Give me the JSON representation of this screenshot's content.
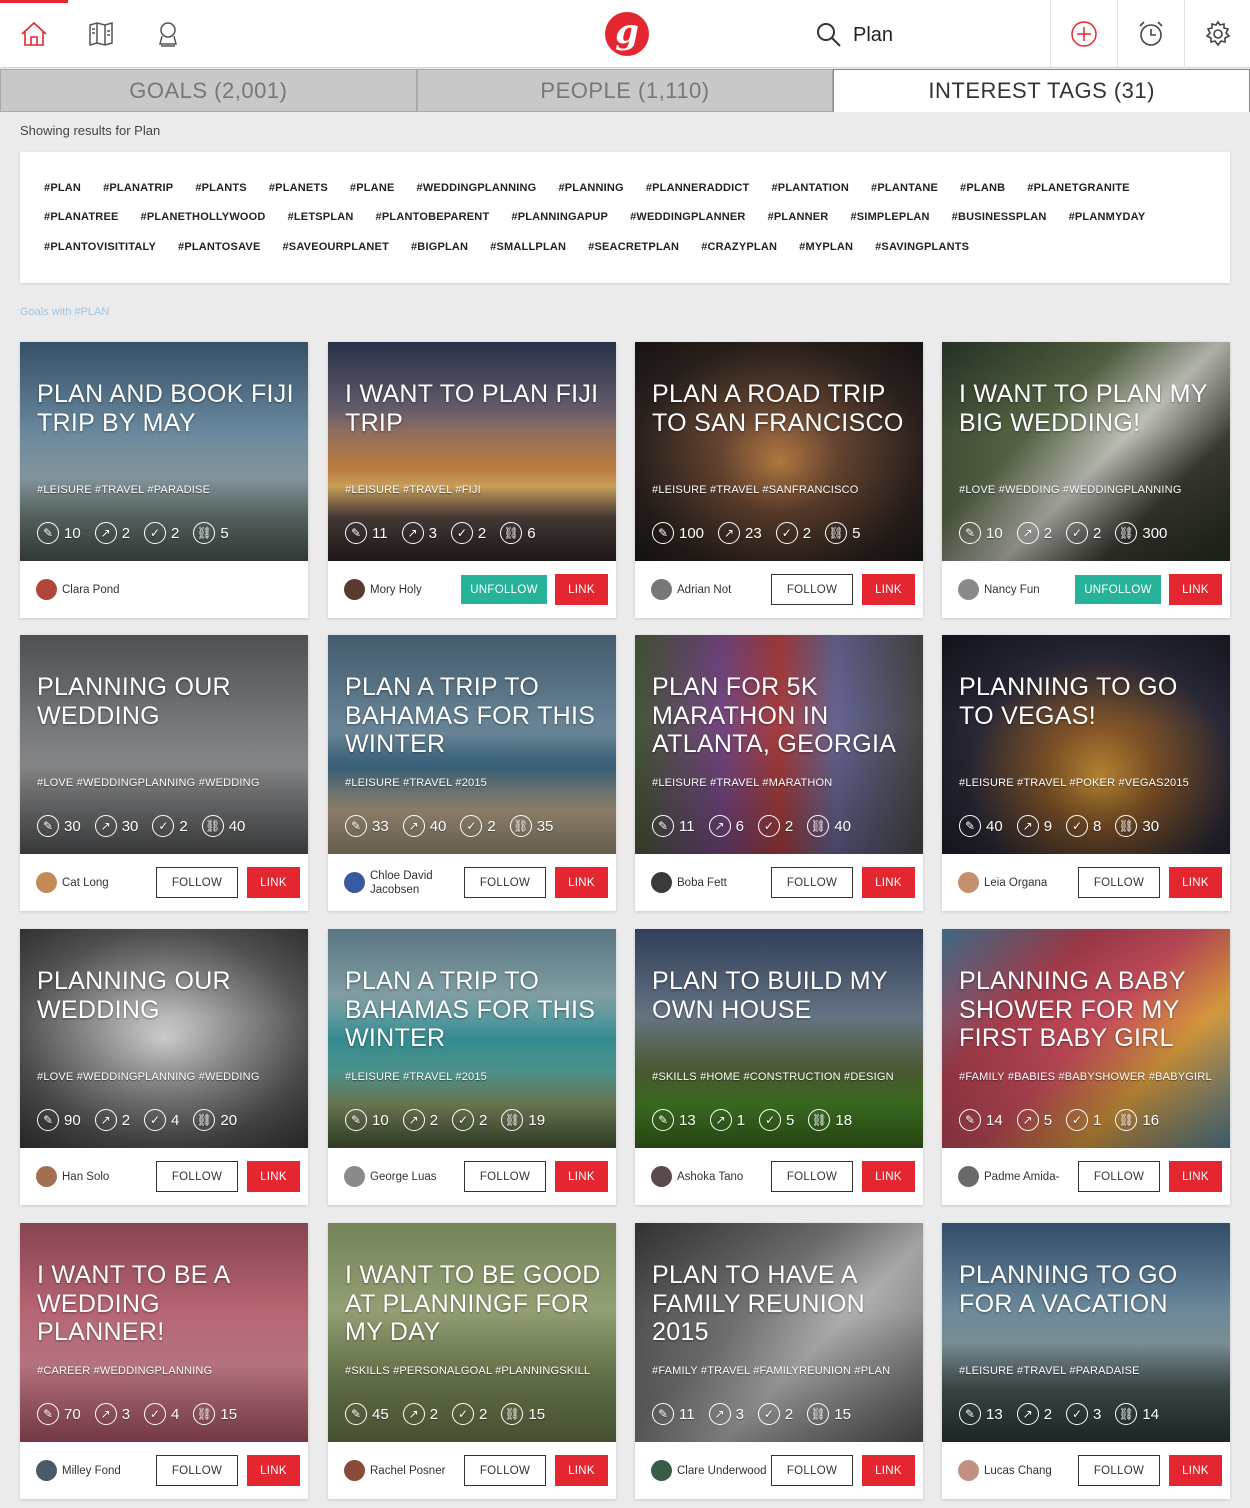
{
  "header": {
    "search_value": "Plan",
    "logo_letter": "g",
    "accent_color": "#e3262f"
  },
  "tabs": [
    {
      "label": "GOALS (2,001)",
      "active": false
    },
    {
      "label": "PEOPLE (1,110)",
      "active": false
    },
    {
      "label": "INTEREST TAGS (31)",
      "active": true
    }
  ],
  "results_text": "Showing results for Plan",
  "tag_rows": [
    [
      "#PLAN",
      "#PLANATRIP",
      "#PLANTS",
      "#PLANETS",
      "#PLANE",
      "#WEDDINGPLANNING",
      "#PLANNING",
      "#PLANNERADDICT",
      "#PLANTATION",
      "#PLANTANE",
      "#PLANB",
      "#PLANETGRANITE"
    ],
    [
      "#PLANATREE",
      "#PLANETHOLLYWOOD",
      "#LETSPLAN",
      "#PLANTOBEPARENT",
      "#PLANNINGAPUP",
      "#WEDDINGPLANNER",
      "#PLANNER",
      "#SIMPLEPLAN",
      "#BUSINESSPLAN",
      "#PLANMYDAY"
    ],
    [
      "#PLANTOVISITITALY",
      "#PLANTOSAVE",
      "#SAVEOURPLANET",
      "#BIGPLAN",
      "#SMALLPLAN",
      "#SEACRETPLAN",
      "#CRAZYPLAN",
      "#MYPLAN",
      "#SAVINGPLANTS"
    ]
  ],
  "section_label": "Goals with #PLAN",
  "cards": [
    {
      "title": "PLAN AND BOOK FIJI TRIP BY MAY",
      "tags": "#LEISURE #TRAVEL #PARADISE",
      "stats": [
        "10",
        "2",
        "2",
        "5"
      ],
      "owner": "Clara Pond",
      "action": "",
      "link": "",
      "bg": "linear-gradient(180deg,#3f5f77 0%,#6d8ea6 40%,#9bb0b8 62%,#6f7f7c 80%,#4c5652 100%)",
      "avatar": "#b0453a"
    },
    {
      "title": "I WANT TO PLAN FIJI TRIP",
      "tags": "#LEISURE #TRAVEL #FIJI",
      "stats": [
        "11",
        "3",
        "2",
        "6"
      ],
      "owner": "Mory Holy",
      "action": "UNFOLLOW",
      "link": "LINK",
      "bg": "linear-gradient(180deg,#2f3a55 0%,#6a6272 30%,#d98f4a 58%,#f3c06c 66%,#5b4a45 80%,#2d2624 100%)",
      "avatar": "#5a3a2e"
    },
    {
      "title": "PLAN A ROAD TRIP TO SAN FRANCISCO",
      "tags": "#LEISURE #TRAVEL #SANFRANCISCO",
      "stats": [
        "100",
        "23",
        "2",
        "5"
      ],
      "owner": "Adrian Not",
      "action": "FOLLOW",
      "link": "LINK",
      "bg": "radial-gradient(ellipse at 50% 55%,#c8874a 0%,#6e4a35 30%,#2e2420 70%,#1a1614 100%)",
      "avatar": "#777777"
    },
    {
      "title": "I WANT TO PLAN MY BIG WEDDING!",
      "tags": "#LOVE #WEDDING #WEDDINGPLANNING",
      "stats": [
        "10",
        "2",
        "2",
        "300"
      ],
      "owner": "Nancy Fun",
      "action": "UNFOLLOW",
      "link": "LINK",
      "bg": "linear-gradient(135deg,#2c3a2a 0%,#5a6a48 35%,#c9ccc2 55%,#3d3f35 75%,#27301f 100%)",
      "avatar": "#8a8a8a"
    },
    {
      "title": "PLANNING OUR WEDDING",
      "tags": "#LOVE #WEDDINGPLANNING #WEDDING",
      "stats": [
        "30",
        "30",
        "2",
        "40"
      ],
      "owner": "Cat Long",
      "action": "FOLLOW",
      "link": "LINK",
      "bg": "linear-gradient(180deg,#5c5f62 0%,#7a7d80 40%,#9a9c9e 60%,#56585a 100%)",
      "avatar": "#c48a55"
    },
    {
      "title": "PLAN A TRIP TO BAHAMAS FOR THIS WINTER",
      "tags": "#LEISURE #TRAVEL #2015",
      "stats": [
        "33",
        "40",
        "2",
        "35"
      ],
      "owner": "Chloe David Jacobsen",
      "action": "FOLLOW",
      "link": "LINK",
      "bg": "linear-gradient(180deg,#4f6c80 0%,#6f8da0 45%,#3f6f8a 60%,#b8a58a 80%,#9c8e78 100%)",
      "avatar": "#3a5aa0"
    },
    {
      "title": "PLAN FOR 5K MARATHON IN ATLANTA, GEORGIA",
      "tags": "#LEISURE #TRAVEL #MARATHON",
      "stats": [
        "11",
        "6",
        "2",
        "40"
      ],
      "owner": "Boba Fett",
      "action": "FOLLOW",
      "link": "LINK",
      "bg": "linear-gradient(90deg,#4a5a3a 0%,#7a4a8a 30%,#b04040 50%,#6a6a9a 70%,#4a4a4a 100%)",
      "avatar": "#3a3a3a"
    },
    {
      "title": "PLANNING TO GO TO VEGAS!",
      "tags": "#LEISURE #TRAVEL #POKER #VEGAS2015",
      "stats": [
        "40",
        "9",
        "8",
        "30"
      ],
      "owner": "Leia Organa",
      "action": "FOLLOW",
      "link": "LINK",
      "bg": "radial-gradient(ellipse at 55% 65%,#d89a3a 0%,#8a5a2a 25%,#2a2a3a 60%,#15151f 100%)",
      "avatar": "#c49070"
    },
    {
      "title": "PLANNING OUR WEDDING",
      "tags": "#LOVE #WEDDINGPLANNING #WEDDING",
      "stats": [
        "90",
        "2",
        "4",
        "20"
      ],
      "owner": "Han Solo",
      "action": "FOLLOW",
      "link": "LINK",
      "bg": "radial-gradient(ellipse at 50% 50%,#e0e0e0 0%,#9a9a9a 35%,#5a5a5a 70%,#3a3a3a 100%)",
      "avatar": "#a07050"
    },
    {
      "title": "PLAN A TRIP TO BAHAMAS FOR THIS WINTER",
      "tags": "#LEISURE #TRAVEL #2015",
      "stats": [
        "10",
        "2",
        "2",
        "19"
      ],
      "owner": "George Luas",
      "action": "FOLLOW",
      "link": "LINK",
      "bg": "linear-gradient(180deg,#6a8a9a 0%,#8aaab0 30%,#3a9aa0 50%,#5ab0a8 65%,#8a9a6a 80%,#4a5a3a 100%)",
      "avatar": "#8a8a8a"
    },
    {
      "title": "PLAN TO BUILD MY OWN HOUSE",
      "tags": "#SKILLS #HOME #CONSTRUCTION #DESIGN",
      "stats": [
        "13",
        "1",
        "5",
        "18"
      ],
      "owner": "Ashoka Tano",
      "action": "FOLLOW",
      "link": "LINK",
      "bg": "linear-gradient(180deg,#3a4a6a 0%,#6a7a8a 40%,#5a6a3a 65%,#4a8a2a 80%,#3a6a1a 100%)",
      "avatar": "#5a4a4a"
    },
    {
      "title": "PLANNING A BABY SHOWER FOR MY FIRST BABY GIRL",
      "tags": "#FAMILY #BABIES #BABYSHOWER #BABYGIRL",
      "stats": [
        "14",
        "5",
        "1",
        "16"
      ],
      "owner": "Padme Amida-",
      "action": "FOLLOW",
      "link": "LINK",
      "bg": "linear-gradient(135deg,#4a7a9a 0%,#b04050 30%,#d05060 50%,#e0a040 70%,#5a8aa0 100%)",
      "avatar": "#6a6a6a"
    },
    {
      "title": "I WANT TO BE A WEDDING PLANNER!",
      "tags": "#CAREER #WEDDINGPLANNING",
      "stats": [
        "70",
        "3",
        "4",
        "15"
      ],
      "owner": "Milley Fond",
      "action": "FOLLOW",
      "link": "LINK",
      "bg": "linear-gradient(180deg,#a05060 0%,#c06a78 40%,#d88a98 65%,#b05868 100%)",
      "avatar": "#4a5a6a"
    },
    {
      "title": "I WANT TO BE GOOD AT PLANNINGF FOR MY DAY",
      "tags": "#SKILLS #PERSONALGOAL #PLANNINGSKILL",
      "stats": [
        "45",
        "2",
        "2",
        "15"
      ],
      "owner": "Rachel Posner",
      "action": "FOLLOW",
      "link": "LINK",
      "bg": "linear-gradient(180deg,#8a9a6a 0%,#9aa87a 40%,#7a8a5a 70%,#6a7a4a 100%)",
      "avatar": "#8a4a3a"
    },
    {
      "title": "PLAN TO HAVE A FAMILY REUNION 2015",
      "tags": "#FAMILY #TRAVEL #FAMILYREUNION #PLAN",
      "stats": [
        "11",
        "3",
        "2",
        "15"
      ],
      "owner": "Clare Underwood",
      "action": "FOLLOW",
      "link": "LINK",
      "bg": "linear-gradient(135deg,#3a3a3a 0%,#7a7a7a 40%,#bababa 60%,#5a5a5a 100%)",
      "avatar": "#3a5a4a"
    },
    {
      "title": "PLANNING TO GO FOR A VACATION",
      "tags": "#LEISURE #TRAVEL #PARADAISE",
      "stats": [
        "13",
        "2",
        "3",
        "14"
      ],
      "owner": "Lucas Chang",
      "action": "FOLLOW",
      "link": "LINK",
      "bg": "linear-gradient(180deg,#3a5a7a 0%,#6a8aa0 35%,#8aa0a8 55%,#4a5a5a 75%,#2a3a3a 100%)",
      "avatar": "#c09080"
    }
  ]
}
